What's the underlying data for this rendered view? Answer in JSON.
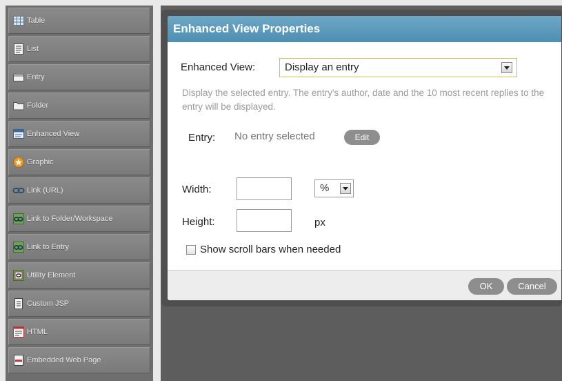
{
  "palette": {
    "items": [
      {
        "label": "Table",
        "icon": "table-icon"
      },
      {
        "label": "List",
        "icon": "list-icon"
      },
      {
        "label": "Entry",
        "icon": "entry-icon"
      },
      {
        "label": "Folder",
        "icon": "folder-icon"
      },
      {
        "label": "Enhanced View",
        "icon": "enhanced-view-icon"
      },
      {
        "label": "Graphic",
        "icon": "graphic-icon"
      },
      {
        "label": "Link (URL)",
        "icon": "link-icon"
      },
      {
        "label": "Link to Folder/Workspace",
        "icon": "link-folder-icon"
      },
      {
        "label": "Link to Entry",
        "icon": "link-entry-icon"
      },
      {
        "label": "Utility Element",
        "icon": "utility-element-icon"
      },
      {
        "label": "Custom JSP",
        "icon": "custom-jsp-icon"
      },
      {
        "label": "HTML",
        "icon": "html-icon"
      },
      {
        "label": "Embedded Web Page",
        "icon": "embedded-web-page-icon"
      }
    ]
  },
  "dialog": {
    "title": "Enhanced View Properties",
    "enhanced_view_label": "Enhanced View:",
    "enhanced_view_value": "Display an entry",
    "description": "Display the selected entry. The entry's author, date and the 10 most recent replies to the entry will be displayed.",
    "entry_label": "Entry:",
    "entry_value": "No entry selected",
    "edit_button": "Edit",
    "width_label": "Width:",
    "width_value": "",
    "width_unit": "%",
    "height_label": "Height:",
    "height_value": "",
    "height_unit": "px",
    "scroll_label": "Show scroll bars when needed",
    "scroll_checked": false,
    "ok_button": "OK",
    "cancel_button": "Cancel"
  },
  "colors": {
    "title_bar": "#5a9abc",
    "select_border": "#e0b54c",
    "palette_bg": "#7f7f7f",
    "pill_button": "#8e8e8e"
  }
}
